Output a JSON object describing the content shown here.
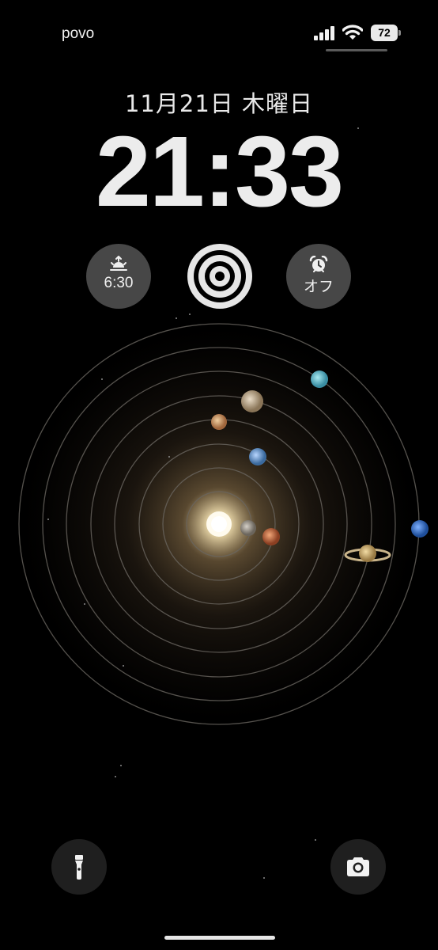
{
  "status_bar": {
    "carrier": "povo",
    "battery_level": "72",
    "signal_icon": "cellular-signal-icon",
    "wifi_icon": "wifi-icon"
  },
  "lock_screen": {
    "date": "11月21日 木曜日",
    "time": "21:33"
  },
  "widgets": {
    "sleep": {
      "icon": "sunrise-icon",
      "value": "6:30"
    },
    "rings": {
      "icon": "activity-rings-icon"
    },
    "alarm": {
      "icon": "alarm-clock-icon",
      "value": "オフ"
    }
  },
  "wallpaper": {
    "type": "solar-system",
    "sun_color": "#fff6d8",
    "orbit_color": "#6a6660"
  },
  "quick_actions": {
    "flashlight_icon": "flashlight-icon",
    "camera_icon": "camera-icon"
  }
}
